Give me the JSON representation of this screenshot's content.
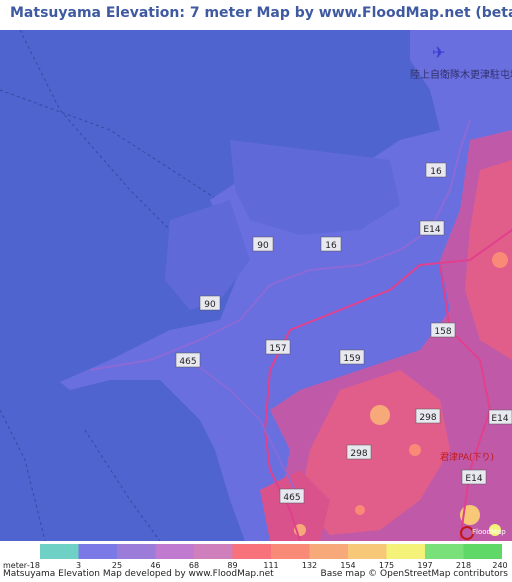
{
  "title": "Matsuyama Elevation: 7 meter Map by www.FloodMap.net (beta)",
  "map": {
    "road_labels": [
      "16",
      "E14",
      "90",
      "16",
      "90",
      "465",
      "157",
      "159",
      "158",
      "298",
      "298",
      "E14",
      "465",
      "E14"
    ],
    "place_labels": [
      "陸上自衛隊木更津駐屯地",
      "君津PA(下り)"
    ],
    "logo_text": "FloodMap"
  },
  "legend": {
    "unit_label": "meter",
    "colors": [
      "#6fd0c6",
      "#7b79e6",
      "#9b7cd8",
      "#c07ad0",
      "#d07fbd",
      "#f7727a",
      "#f98a78",
      "#f8a97a",
      "#f6c878",
      "#f4f278",
      "#79e07a",
      "#5fd867"
    ],
    "values": [
      "-18",
      "3",
      "25",
      "46",
      "68",
      "89",
      "111",
      "132",
      "154",
      "175",
      "197",
      "218",
      "240"
    ]
  },
  "footer": {
    "left": "Matsuyama Elevation Map developed by www.FloodMap.net",
    "right": "Base map © OpenStreetMap contributors"
  },
  "colors": {
    "sea": "#4f64cf",
    "land": "#6a6fe0",
    "highland": "#c05aa8",
    "hills": "#e25e8a"
  }
}
